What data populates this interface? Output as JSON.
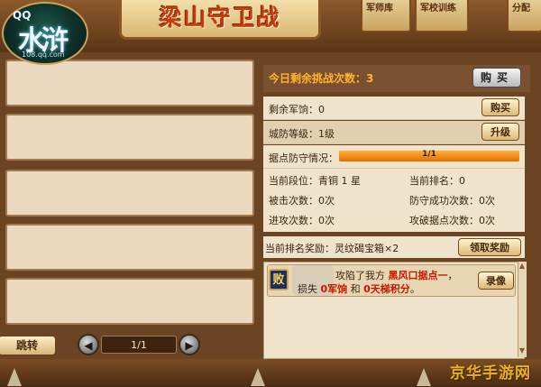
{
  "logo": {
    "qq": "QQ",
    "name": "水浒",
    "url": "108.qq.com"
  },
  "title": "梁山守卫战",
  "tabs": {
    "army": "军师库",
    "army2": "军校训练",
    "alloc": "分配"
  },
  "pager": {
    "jump_label": "跳转",
    "page": "1/1"
  },
  "challenge": {
    "remaining_label": "今日剩余挑战次数：3",
    "buy_label": "购买"
  },
  "info": {
    "rations_label": "剩余军饷：0",
    "rations_buy": "购买",
    "defense_label": "城防等级：1级",
    "upgrade": "升级",
    "stronghold_label": "据点防守情况：",
    "stronghold_progress_text": "1/1",
    "stronghold_progress": 1.0
  },
  "stats": {
    "rank_tier": "当前段位：青铜 1 星",
    "current_rank": "当前排名：0",
    "attacked": "被击次数：0次",
    "defended": "防守成功次数：0次",
    "attacks": "进攻次数：0次",
    "captured": "攻破据点次数：0次"
  },
  "reward": {
    "label": "当前排名奖励：灵纹碣宝箱×2",
    "claim": "领取奖励"
  },
  "log": {
    "badge": "败",
    "line1_a": "攻陷了我方 ",
    "line1_b": "黑风口据点一",
    "line1_c": "，",
    "line2_a": "损失 ",
    "line2_b": "0军饷",
    "line2_c": " 和 ",
    "line2_d": "0天梯积分",
    "line2_e": "。",
    "replay": "录像"
  },
  "watermark": "京华手游网",
  "colors": {
    "accent": "#ffb32e",
    "progress": "#e66f00",
    "wood": "#6b4424",
    "panel": "#efe3cc"
  }
}
